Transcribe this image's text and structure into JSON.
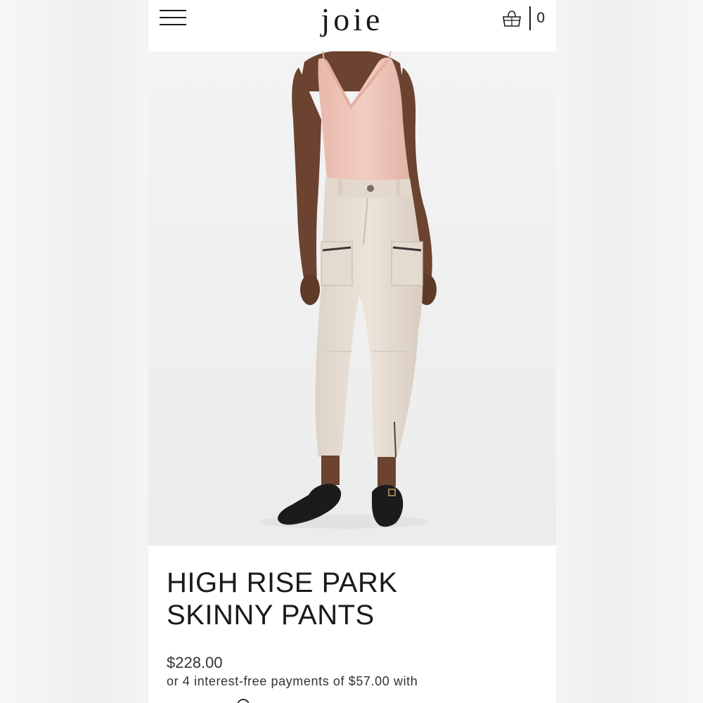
{
  "header": {
    "brand": "joie",
    "menu_icon": "hamburger-menu-icon",
    "cart_icon": "shopping-bag-icon",
    "cart_count": "0"
  },
  "product": {
    "image_alt": "Model wearing High Rise Park Skinny Pants",
    "title_line1": "HIGH RISE PARK",
    "title_line2": "SKINNY PANTS",
    "price": "$228.00",
    "installments": "or 4 interest-free payments of $57.00 with"
  },
  "colors": {
    "background": "#ffffff",
    "text": "#1a1a1a",
    "top_blush": "#efc7bd",
    "pants_ecru": "#e9dfd6",
    "skin": "#6b4330",
    "shoes": "#1b1b1b"
  }
}
